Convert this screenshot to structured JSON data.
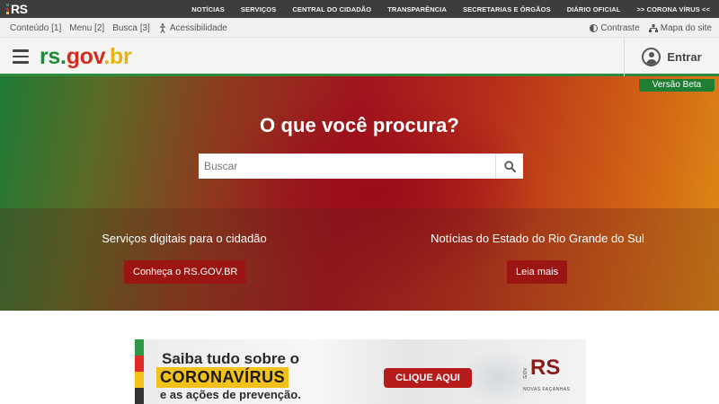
{
  "govbar": {
    "logo_text": "RS",
    "links": [
      "NOTÍCIAS",
      "SERVIÇOS",
      "CENTRAL DO CIDADÃO",
      "TRANSPARÊNCIA",
      "SECRETARIAS E ÓRGÃOS",
      "DIÁRIO OFICIAL",
      ">> CORONA VÍRUS <<"
    ]
  },
  "accessibility": {
    "content": "Conteúdo [1]",
    "menu": "Menu [2]",
    "search": "Busca [3]",
    "accessibility": "Acessibilidade",
    "contrast": "Contraste",
    "sitemap": "Mapa do site"
  },
  "header": {
    "brand_part1": "rs.",
    "brand_part2": "gov",
    "brand_part3": ".br",
    "login_label": "Entrar",
    "beta_label": "Versão Beta"
  },
  "hero": {
    "title": "O que você procura?",
    "search_placeholder": "Buscar"
  },
  "sections": {
    "services_title": "Serviços digitais para o cidadão",
    "services_button": "Conheça o RS.GOV.BR",
    "news_title": "Notícias do Estado do Rio Grande do Sul",
    "news_button": "Leia mais"
  },
  "banner": {
    "line1": "Saiba tudo sobre o",
    "line2": "CORONAVÍRUS",
    "line3": "e as ações de prevenção.",
    "cta": "CLIQUE AQUI",
    "logo_gov": "GOV",
    "logo_rs": "RS",
    "logo_slogan": "NOVAS FAÇANHAS"
  },
  "colors": {
    "brand_green": "#1f8a3a",
    "brand_red": "#d22d1e",
    "brand_yellow": "#e6b415",
    "button_red": "#9b1512",
    "beta_green": "#1e7e34"
  }
}
